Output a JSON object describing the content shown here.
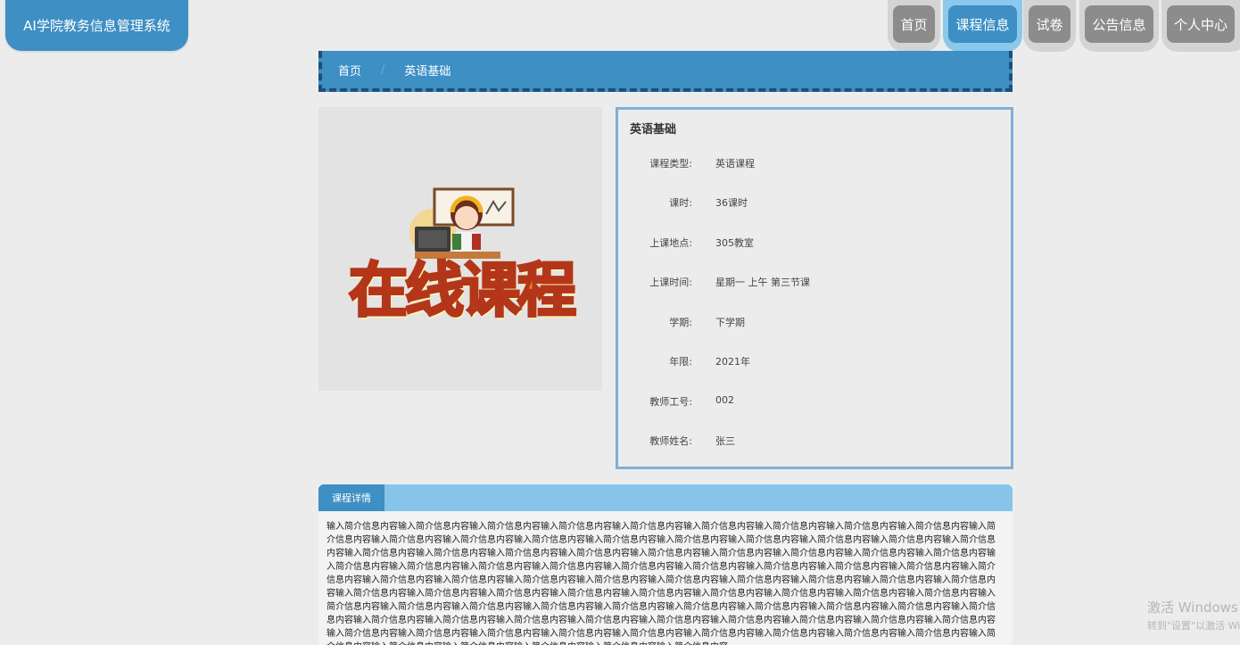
{
  "app": {
    "title": "AI学院教务信息管理系统"
  },
  "nav": {
    "items": [
      "首页",
      "课程信息",
      "试卷",
      "公告信息",
      "个人中心"
    ],
    "active": "课程信息"
  },
  "breadcrumb": {
    "home": "首页",
    "current": "英语基础"
  },
  "course_image": {
    "banner_text": "在线课程"
  },
  "course": {
    "title": "英语基础",
    "fields": [
      {
        "label": "课程类型:",
        "value": "英语课程"
      },
      {
        "label": "课时:",
        "value": "36课时"
      },
      {
        "label": "上课地点:",
        "value": "305教室"
      },
      {
        "label": "上课时间:",
        "value": "星期一 上午 第三节课"
      },
      {
        "label": "学期:",
        "value": "下学期"
      },
      {
        "label": "年限:",
        "value": "2021年"
      },
      {
        "label": "教师工号:",
        "value": "002"
      },
      {
        "label": "教师姓名:",
        "value": "张三"
      }
    ]
  },
  "detail": {
    "tab_label": "课程详情",
    "content": "输入简介信息内容输入简介信息内容输入简介信息内容输入简介信息内容输入简介信息内容输入简介信息内容输入简介信息内容输入简介信息内容输入简介信息内容输入简介信息内容输入简介信息内容输入简介信息内容输入简介信息内容输入简介信息内容输入简介信息内容输入简介信息内容输入简介信息内容输入简介信息内容输入简介信息内容输入简介信息内容输入简介信息内容输入简介信息内容输入简介信息内容输入简介信息内容输入简介信息内容输入简介信息内容输入简介信息内容输入简介信息内容输入简介信息内容输入简介信息内容输入简介信息内容输入简介信息内容输入简介信息内容输入简介信息内容输入简介信息内容输入简介信息内容输入简介信息内容输入简介信息内容输入简介信息内容输入简介信息内容输入简介信息内容输入简介信息内容输入简介信息内容输入简介信息内容输入简介信息内容输入简介信息内容输入简介信息内容输入简介信息内容输入简介信息内容输入简介信息内容输入简介信息内容输入简介信息内容输入简介信息内容输入简介信息内容输入简介信息内容输入简介信息内容输入简介信息内容输入简介信息内容输入简介信息内容输入简介信息内容输入简介信息内容输入简介信息内容输入简介信息内容输入简介信息内容输入简介信息内容输入简介信息内容输入简介信息内容输入简介信息内容输入简介信息内容输入简介信息内容输入简介信息内容输入简介信息内容输入简介信息内容输入简介信息内容输入简介信息内容输入简介信息内容输入简介信息内容输入简介信息内容输入简介信息内容输入简介信息内容输入简介信息内容输入简介信息内容输入简介信息内容输入简介信息内容输入简介信息内容输入简介信息内容输入简介信息内容输入简介信息内容输入简介信息内容输入简介信息内容"
  },
  "watermark": {
    "line1": "激活 Windows",
    "line2": "转到\"设置\"以激活 Windows。"
  }
}
